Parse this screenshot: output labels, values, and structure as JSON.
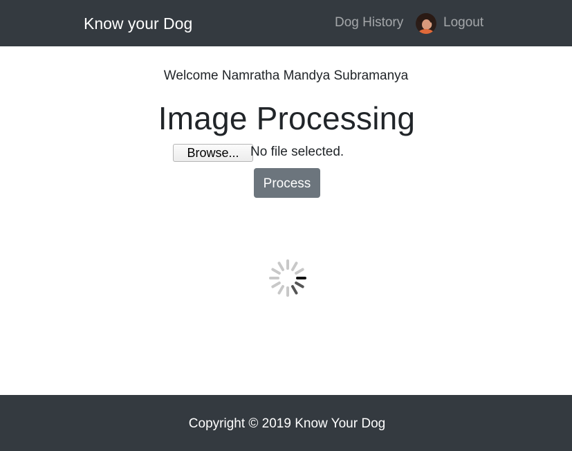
{
  "navbar": {
    "brand": "Know your Dog",
    "links": {
      "history": "Dog History",
      "logout": "Logout"
    },
    "avatar_icon": "user-avatar-icon"
  },
  "main": {
    "welcome": "Welcome Namratha Mandya Subramanya",
    "title": "Image Processing",
    "file_input": {
      "button_label": "Browse...",
      "status": "No file selected."
    },
    "process_button": "Process",
    "spinner_icon": "loading-spinner-icon"
  },
  "footer": {
    "copyright": "Copyright © 2019 Know Your Dog"
  },
  "colors": {
    "navbar_bg": "#343a40",
    "footer_bg": "#343a40",
    "button_secondary": "#6c757d"
  }
}
